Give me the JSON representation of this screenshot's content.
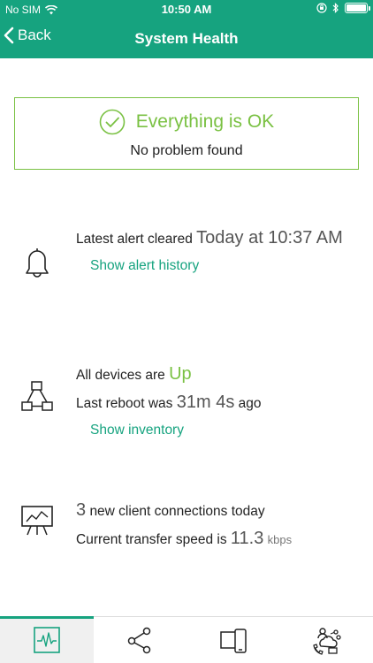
{
  "status_bar": {
    "carrier": "No SIM",
    "time": "10:50 AM",
    "icons": [
      "wifi-icon",
      "rotation-lock-icon",
      "bluetooth-icon",
      "battery-icon"
    ],
    "battery_level": 1.0
  },
  "nav": {
    "back_label": "Back",
    "title": "System Health"
  },
  "status_box": {
    "title": "Everything is OK",
    "subtitle": "No problem found",
    "color": "#7ac143"
  },
  "alerts": {
    "icon": "bell-icon",
    "prefix": "Latest alert cleared",
    "value": "Today at 10:37 AM",
    "link": "Show alert history"
  },
  "devices": {
    "icon": "network-topology-icon",
    "line1_prefix": "All devices are",
    "line1_value": "Up",
    "line2_prefix": "Last reboot was",
    "line2_value": "31m 4s",
    "line2_suffix": "ago",
    "link": "Show inventory"
  },
  "clients": {
    "icon": "presentation-chart-icon",
    "count": "3",
    "count_suffix": "new client connections today",
    "speed_prefix": "Current transfer speed is",
    "speed_value": "11.3",
    "speed_unit": "kbps"
  },
  "tabs": [
    {
      "icon": "health-pulse-icon",
      "active": true
    },
    {
      "icon": "share-network-icon",
      "active": false
    },
    {
      "icon": "devices-icon",
      "active": false
    },
    {
      "icon": "clients-icon",
      "active": false
    }
  ],
  "colors": {
    "brand": "#16a37f",
    "ok": "#7ac143"
  }
}
